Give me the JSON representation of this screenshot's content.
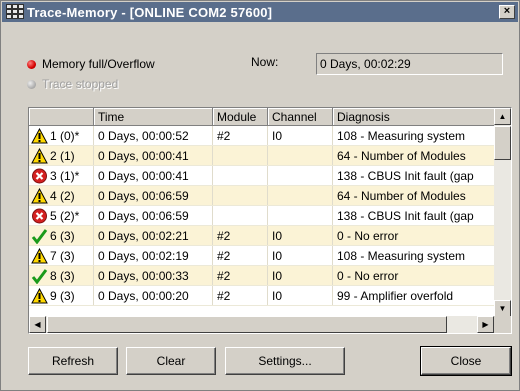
{
  "window": {
    "title": "Trace-Memory - [ONLINE COM2 57600]",
    "close_label": "×"
  },
  "status": {
    "memory_full": "Memory full/Overflow",
    "trace_stopped": "Trace stopped",
    "now_label": "Now:",
    "now_value": "0 Days, 00:02:29"
  },
  "table": {
    "columns": [
      "",
      "Time",
      "Module",
      "Channel",
      "Diagnosis"
    ],
    "rows": [
      {
        "icon": "warning-icon",
        "id": "1 (0)*",
        "time": "0 Days, 00:00:52",
        "module": "#2",
        "channel": "I0",
        "diagnosis": "108 - Measuring system"
      },
      {
        "icon": "warning-icon",
        "id": "2 (1)",
        "time": "0 Days, 00:00:41",
        "module": "",
        "channel": "",
        "diagnosis": "64 - Number of Modules"
      },
      {
        "icon": "error-icon",
        "id": "3 (1)*",
        "time": "0 Days, 00:00:41",
        "module": "",
        "channel": "",
        "diagnosis": "138 - CBUS Init fault (gap"
      },
      {
        "icon": "warning-icon",
        "id": "4 (2)",
        "time": "0 Days, 00:06:59",
        "module": "",
        "channel": "",
        "diagnosis": "64 - Number of Modules"
      },
      {
        "icon": "error-icon",
        "id": "5 (2)*",
        "time": "0 Days, 00:06:59",
        "module": "",
        "channel": "",
        "diagnosis": "138 - CBUS Init fault (gap"
      },
      {
        "icon": "check-icon",
        "id": "6 (3)",
        "time": "0 Days, 00:02:21",
        "module": "#2",
        "channel": "I0",
        "diagnosis": "0 - No error"
      },
      {
        "icon": "warning-icon",
        "id": "7 (3)",
        "time": "0 Days, 00:02:19",
        "module": "#2",
        "channel": "I0",
        "diagnosis": "108 - Measuring system"
      },
      {
        "icon": "check-icon",
        "id": "8 (3)",
        "time": "0 Days, 00:00:33",
        "module": "#2",
        "channel": "I0",
        "diagnosis": "0 - No error"
      },
      {
        "icon": "warning-icon",
        "id": "9 (3)",
        "time": "0 Days, 00:00:20",
        "module": "#2",
        "channel": "I0",
        "diagnosis": "99 - Amplifier overfold"
      }
    ]
  },
  "buttons": {
    "refresh": "Refresh",
    "clear": "Clear",
    "settings": "Settings...",
    "close": "Close"
  }
}
